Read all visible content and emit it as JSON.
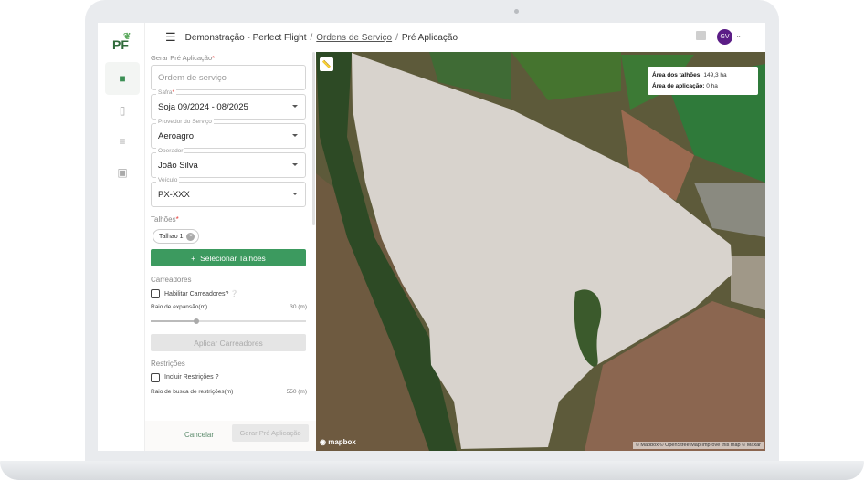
{
  "header": {
    "breadcrumb": [
      "Demonstração - Perfect Flight",
      "Ordens de Serviço",
      "Pré Aplicação"
    ],
    "avatar": "GV"
  },
  "logo": "PF",
  "form": {
    "title": "Gerar Pré Aplicação",
    "required_mark": "*",
    "order_placeholder": "Ordem de serviço",
    "safra": {
      "label": "Safra",
      "value": "Soja 09/2024 - 08/2025"
    },
    "provider": {
      "label": "Provedor do Serviço",
      "value": "Aeroagro"
    },
    "operator": {
      "label": "Operador",
      "value": "João Silva"
    },
    "vehicle": {
      "label": "Veículo",
      "value": "PX-XXX"
    },
    "talhoes_label": "Talhões",
    "chip": "Talhao 1",
    "select_button": "Selecionar Talhões",
    "carreadores": {
      "section": "Carreadores",
      "checkbox": "Habilitar Carreadores?",
      "radius_label": "Raio de expansão(m)",
      "radius_value": "30 (m)",
      "radius_fraction": 0.3,
      "apply": "Aplicar Carreadores"
    },
    "restricoes": {
      "section": "Restrições",
      "checkbox": "Incluir Restrições ?",
      "radius_label": "Raio de busca de restrições(m)",
      "radius_value": "550 (m)"
    },
    "cancel": "Cancelar",
    "submit": "Gerar Pré Aplicação"
  },
  "map": {
    "info": {
      "area_talhoes_label": "Área dos talhões:",
      "area_talhoes": "149,3 ha",
      "area_aplicacao_label": "Área de aplicação:",
      "area_aplicacao": "0 ha"
    },
    "logo": "mapbox",
    "attribution": "© Mapbox © OpenStreetMap Improve this map © Maxar"
  }
}
